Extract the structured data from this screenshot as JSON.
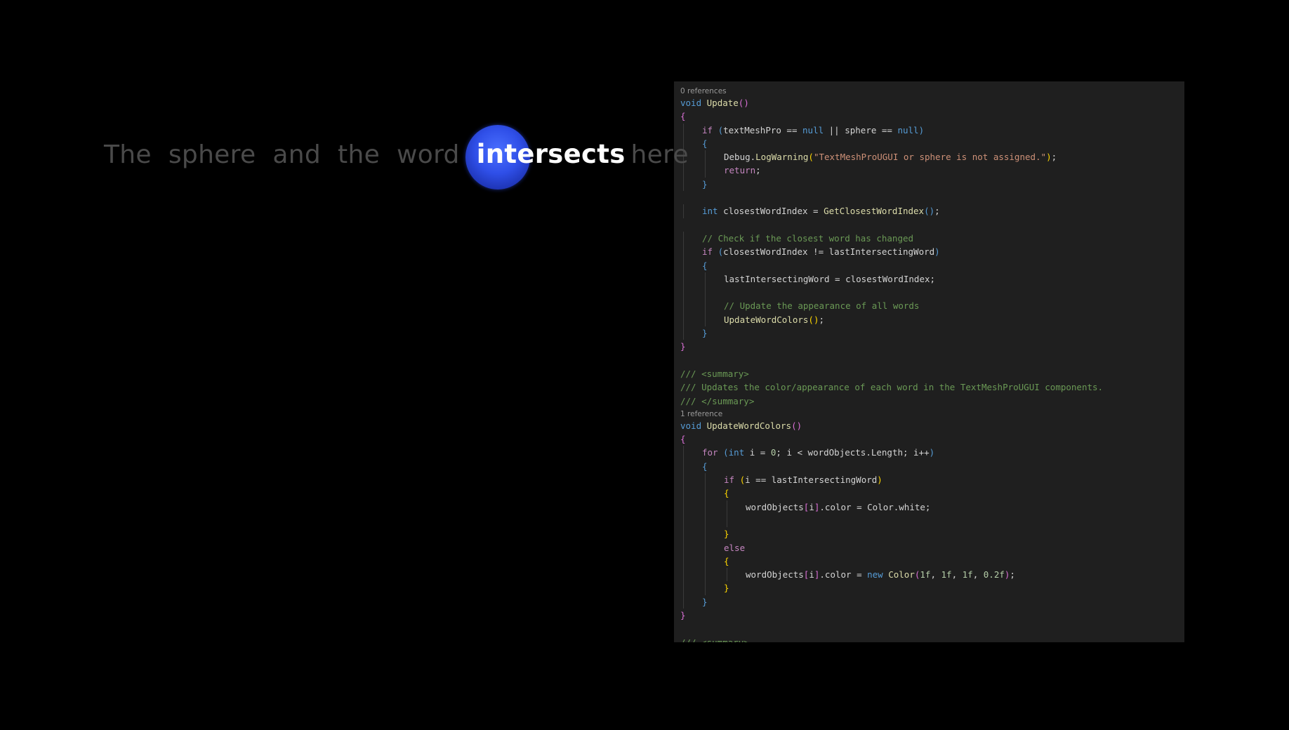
{
  "demo": {
    "words": [
      {
        "text": "The",
        "active": false
      },
      {
        "text": "sphere",
        "active": false
      },
      {
        "text": "and",
        "active": false
      },
      {
        "text": "the",
        "active": false
      },
      {
        "text": "word",
        "active": false
      },
      {
        "text": "intersects",
        "active": true
      },
      {
        "text": "here",
        "active": false
      }
    ],
    "colors": {
      "inactive_word": "#4a4a4a",
      "active_word": "#ffffff",
      "sphere": "#2f4fe8"
    }
  },
  "editor": {
    "background": "#1f1f1f",
    "lines": [
      {
        "type": "lens",
        "text": "0 references"
      },
      {
        "indent": 0,
        "segs": [
          [
            "kw",
            "void"
          ],
          [
            "plain",
            " "
          ],
          [
            "fn",
            "Update"
          ],
          [
            "p1",
            "()"
          ]
        ]
      },
      {
        "indent": 0,
        "segs": [
          [
            "p1",
            "{"
          ]
        ]
      },
      {
        "indent": 1,
        "segs": [
          [
            "ctl",
            "if"
          ],
          [
            "plain",
            " "
          ],
          [
            "p2",
            "("
          ],
          [
            "plain",
            "textMeshPro == "
          ],
          [
            "kw",
            "null"
          ],
          [
            "plain",
            " || sphere == "
          ],
          [
            "kw",
            "null"
          ],
          [
            "p2",
            ")"
          ]
        ]
      },
      {
        "indent": 1,
        "segs": [
          [
            "p2",
            "{"
          ]
        ]
      },
      {
        "indent": 2,
        "segs": [
          [
            "plain",
            "Debug."
          ],
          [
            "fn",
            "LogWarning"
          ],
          [
            "p3",
            "("
          ],
          [
            "str",
            "\"TextMeshProUGUI or sphere is not assigned.\""
          ],
          [
            "p3",
            ")"
          ],
          [
            "plain",
            ";"
          ]
        ]
      },
      {
        "indent": 2,
        "segs": [
          [
            "ctl",
            "return"
          ],
          [
            "plain",
            ";"
          ]
        ]
      },
      {
        "indent": 1,
        "segs": [
          [
            "p2",
            "}"
          ]
        ]
      },
      {
        "indent": 0,
        "segs": []
      },
      {
        "indent": 1,
        "segs": [
          [
            "kw",
            "int"
          ],
          [
            "plain",
            " closestWordIndex = "
          ],
          [
            "fn",
            "GetClosestWordIndex"
          ],
          [
            "p2",
            "()"
          ],
          [
            "plain",
            ";"
          ]
        ]
      },
      {
        "indent": 0,
        "segs": []
      },
      {
        "indent": 1,
        "segs": [
          [
            "cm",
            "// Check if the closest word has changed"
          ]
        ]
      },
      {
        "indent": 1,
        "segs": [
          [
            "ctl",
            "if"
          ],
          [
            "plain",
            " "
          ],
          [
            "p2",
            "("
          ],
          [
            "plain",
            "closestWordIndex != lastIntersectingWord"
          ],
          [
            "p2",
            ")"
          ]
        ]
      },
      {
        "indent": 1,
        "segs": [
          [
            "p2",
            "{"
          ]
        ]
      },
      {
        "indent": 2,
        "segs": [
          [
            "plain",
            "lastIntersectingWord = closestWordIndex;"
          ]
        ]
      },
      {
        "indent": 0,
        "segs": [],
        "guides": 2
      },
      {
        "indent": 2,
        "segs": [
          [
            "cm",
            "// Update the appearance of all words"
          ]
        ]
      },
      {
        "indent": 2,
        "segs": [
          [
            "fn",
            "UpdateWordColors"
          ],
          [
            "p3",
            "()"
          ],
          [
            "plain",
            ";"
          ]
        ]
      },
      {
        "indent": 1,
        "segs": [
          [
            "p2",
            "}"
          ]
        ]
      },
      {
        "indent": 0,
        "segs": [
          [
            "p1",
            "}"
          ]
        ]
      },
      {
        "indent": 0,
        "segs": []
      },
      {
        "indent": 0,
        "segs": [
          [
            "cm",
            "/// <summary>"
          ]
        ]
      },
      {
        "indent": 0,
        "segs": [
          [
            "cm",
            "/// Updates the color/appearance of each word in the TextMeshProUGUI components."
          ]
        ]
      },
      {
        "indent": 0,
        "segs": [
          [
            "cm",
            "/// </summary>"
          ]
        ]
      },
      {
        "type": "lens",
        "text": "1 reference"
      },
      {
        "indent": 0,
        "segs": [
          [
            "kw",
            "void"
          ],
          [
            "plain",
            " "
          ],
          [
            "fn",
            "UpdateWordColors"
          ],
          [
            "p1",
            "()"
          ]
        ]
      },
      {
        "indent": 0,
        "segs": [
          [
            "p1",
            "{"
          ]
        ]
      },
      {
        "indent": 1,
        "segs": [
          [
            "ctl",
            "for"
          ],
          [
            "plain",
            " "
          ],
          [
            "p2",
            "("
          ],
          [
            "kw",
            "int"
          ],
          [
            "plain",
            " i = "
          ],
          [
            "num",
            "0"
          ],
          [
            "plain",
            "; i < wordObjects.Length; i++"
          ],
          [
            "p2",
            ")"
          ]
        ]
      },
      {
        "indent": 1,
        "segs": [
          [
            "p2",
            "{"
          ]
        ]
      },
      {
        "indent": 2,
        "segs": [
          [
            "ctl",
            "if"
          ],
          [
            "plain",
            " "
          ],
          [
            "p3",
            "("
          ],
          [
            "plain",
            "i == lastIntersectingWord"
          ],
          [
            "p3",
            ")"
          ]
        ]
      },
      {
        "indent": 2,
        "segs": [
          [
            "p3",
            "{"
          ]
        ]
      },
      {
        "indent": 3,
        "segs": [
          [
            "plain",
            "wordObjects"
          ],
          [
            "p1",
            "["
          ],
          [
            "plain",
            "i"
          ],
          [
            "p1",
            "]"
          ],
          [
            "plain",
            ".color = Color.white;"
          ]
        ]
      },
      {
        "indent": 0,
        "segs": [],
        "guides": 3
      },
      {
        "indent": 2,
        "segs": [
          [
            "p3",
            "}"
          ]
        ]
      },
      {
        "indent": 2,
        "segs": [
          [
            "ctl",
            "else"
          ]
        ]
      },
      {
        "indent": 2,
        "segs": [
          [
            "p3",
            "{"
          ]
        ]
      },
      {
        "indent": 3,
        "segs": [
          [
            "plain",
            "wordObjects"
          ],
          [
            "p1",
            "["
          ],
          [
            "plain",
            "i"
          ],
          [
            "p1",
            "]"
          ],
          [
            "plain",
            ".color = "
          ],
          [
            "kw",
            "new"
          ],
          [
            "plain",
            " "
          ],
          [
            "fn",
            "Color"
          ],
          [
            "p1",
            "("
          ],
          [
            "num",
            "1f"
          ],
          [
            "plain",
            ", "
          ],
          [
            "num",
            "1f"
          ],
          [
            "plain",
            ", "
          ],
          [
            "num",
            "1f"
          ],
          [
            "plain",
            ", "
          ],
          [
            "num",
            "0.2f"
          ],
          [
            "p1",
            ")"
          ],
          [
            "plain",
            ";"
          ]
        ]
      },
      {
        "indent": 2,
        "segs": [
          [
            "p3",
            "}"
          ]
        ]
      },
      {
        "indent": 1,
        "segs": [
          [
            "p2",
            "}"
          ]
        ]
      },
      {
        "indent": 0,
        "segs": [
          [
            "p1",
            "}"
          ]
        ]
      },
      {
        "indent": 0,
        "segs": []
      },
      {
        "indent": 0,
        "segs": [
          [
            "cm",
            "/// <summary>"
          ]
        ]
      }
    ]
  }
}
